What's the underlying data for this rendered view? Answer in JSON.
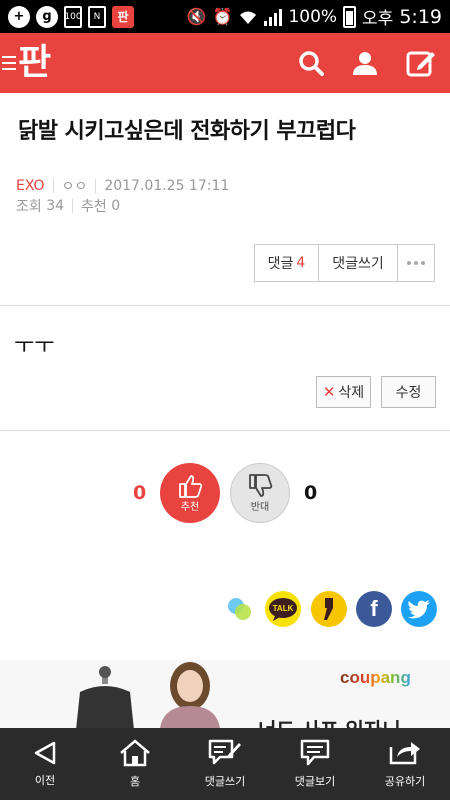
{
  "status_bar": {
    "battery_text": "100%",
    "battery_level": 1.0,
    "ampm": "오후",
    "time": "5:19"
  },
  "app_bar": {
    "logo": "판"
  },
  "post": {
    "title": "닭발 시키고싶은데 전화하기 부끄럽다",
    "category": "EXO",
    "author": "ㅇㅇ",
    "datetime": "2017.01.25 17:11",
    "views_label": "조회",
    "views": "34",
    "recommends_label": "추천",
    "recommends": "0",
    "body": "ㅜㅜ"
  },
  "comment_bar": {
    "comment_label": "댓글",
    "comment_count": "4",
    "write_label": "댓글쓰기"
  },
  "actions": {
    "delete_label": "삭제",
    "edit_label": "수정"
  },
  "votes": {
    "up_count": "0",
    "up_label": "추천",
    "down_count": "0",
    "down_label": "반대"
  },
  "share": {
    "talk_label": "TALK",
    "facebook_glyph": "f"
  },
  "ad": {
    "brand": "coupang",
    "headline": "너도 사포 입자니"
  },
  "bottom_nav": [
    {
      "label": "이전",
      "icon": "back-arrow-icon"
    },
    {
      "label": "홈",
      "icon": "home-icon"
    },
    {
      "label": "댓글쓰기",
      "icon": "comment-write-icon"
    },
    {
      "label": "댓글보기",
      "icon": "comment-view-icon"
    },
    {
      "label": "공유하기",
      "icon": "share-icon"
    }
  ],
  "colors": {
    "brand_red": "#e8433f",
    "bottom_bar": "#2b2b2b",
    "kakao_yellow": "#f7e10a",
    "facebook": "#3b5998",
    "twitter": "#1da1f2"
  }
}
